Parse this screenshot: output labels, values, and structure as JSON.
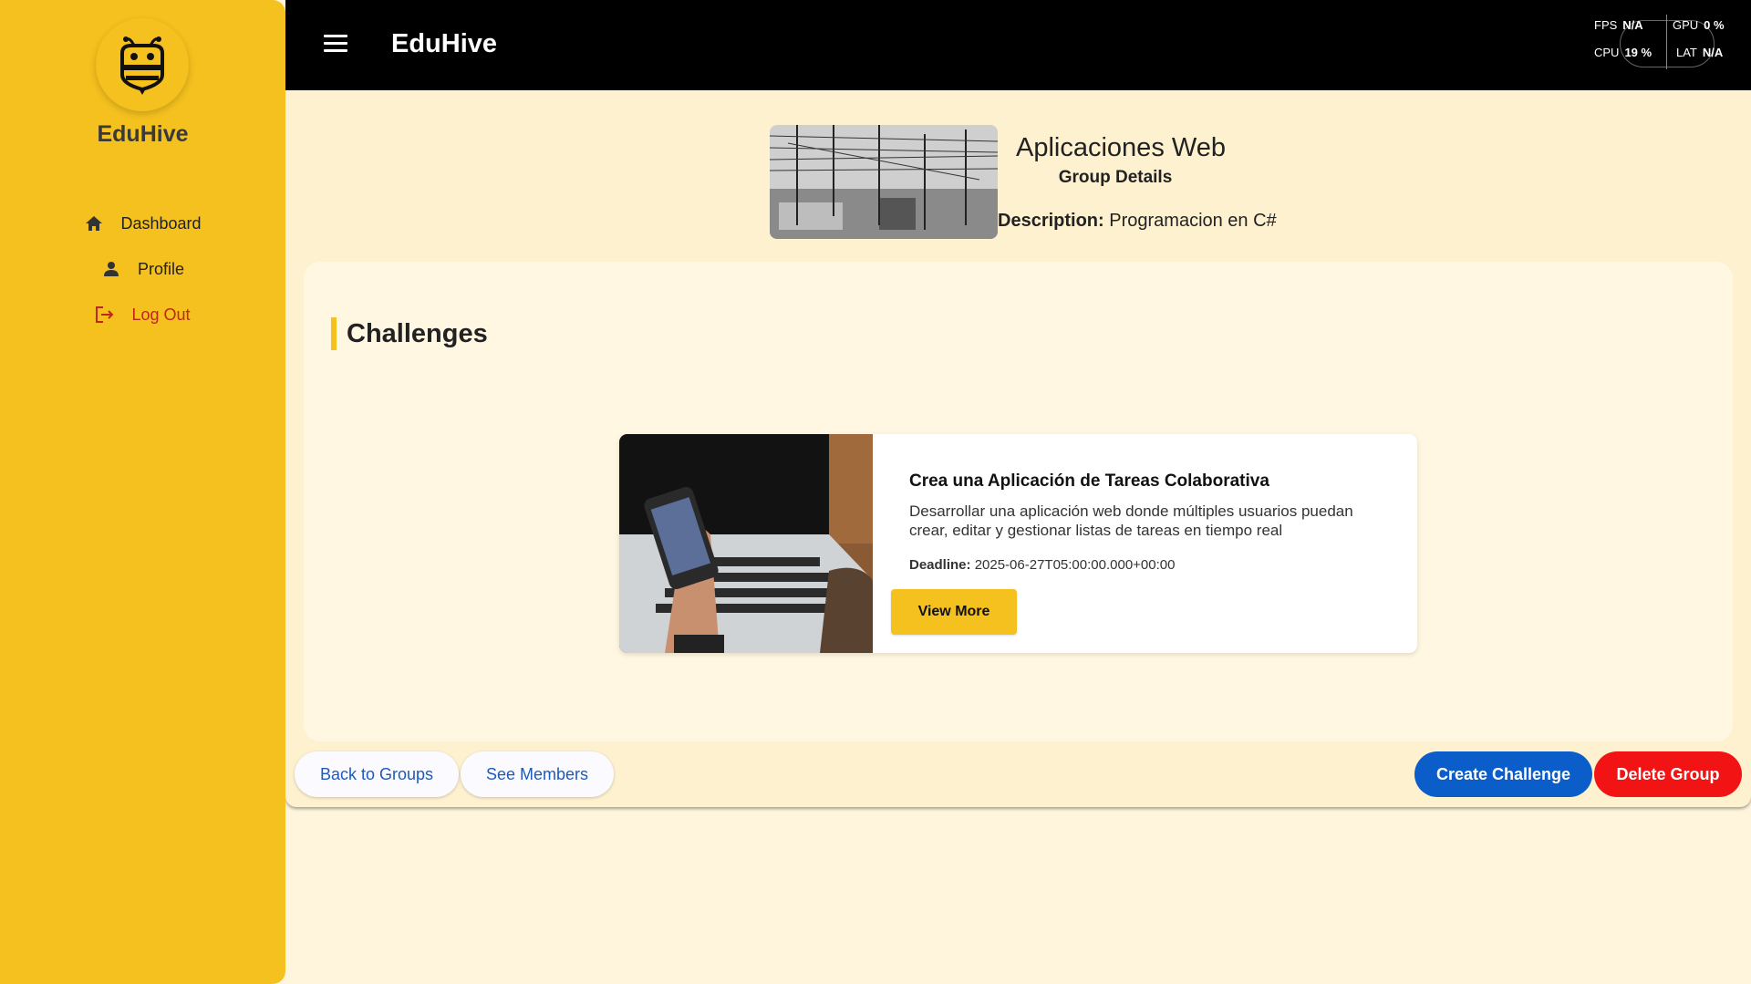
{
  "sidebar": {
    "brand": "EduHive",
    "items": [
      {
        "label": "Dashboard",
        "icon": "home-icon"
      },
      {
        "label": "Profile",
        "icon": "person-icon"
      },
      {
        "label": "Log Out",
        "icon": "logout-icon"
      }
    ]
  },
  "topbar": {
    "title": "EduHive",
    "perf": {
      "fps_label": "FPS",
      "fps_value": "N/A",
      "gpu_label": "GPU",
      "gpu_value": "0 %",
      "cpu_label": "CPU",
      "cpu_value": "19 %",
      "lat_label": "LAT",
      "lat_value": "N/A"
    }
  },
  "group": {
    "title": "Aplicaciones Web",
    "subtitle": "Group Details",
    "description_label": "Description:",
    "description": "Programacion en C#"
  },
  "challenges": {
    "heading": "Challenges",
    "items": [
      {
        "title": "Crea una Aplicación de Tareas Colaborativa",
        "description": "Desarrollar una aplicación web donde múltiples usuarios puedan crear, editar y gestionar listas de tareas en tiempo real",
        "deadline_label": "Deadline:",
        "deadline": "2025-06-27T05:00:00.000+00:00",
        "button": "View More"
      }
    ]
  },
  "actions": {
    "back": "Back to Groups",
    "members": "See Members",
    "create": "Create Challenge",
    "delete": "Delete Group"
  },
  "colors": {
    "sidebar": "#f5c11e",
    "topbar": "#000000",
    "background": "#fef5dc",
    "primary": "#0b5ec9",
    "danger": "#f21414",
    "logout": "#c0271b"
  }
}
